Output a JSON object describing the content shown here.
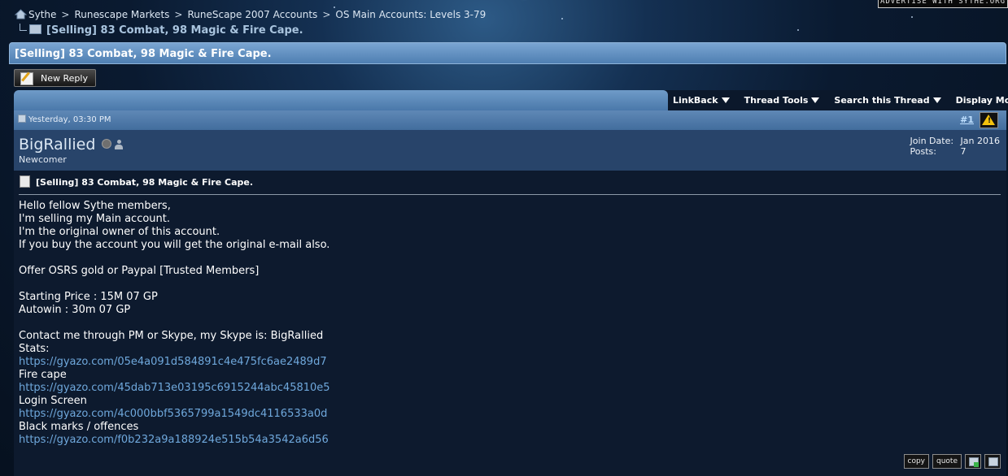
{
  "advertise": "ADVERTISE WITH SYTHE.ORG",
  "breadcrumb": {
    "items": [
      "Sythe",
      "Runescape Markets",
      "RuneScape 2007 Accounts",
      "OS Main Accounts: Levels 3-79"
    ],
    "separator": ">",
    "current": "[Selling] 83 Combat, 98 Magic & Fire Cape."
  },
  "thread": {
    "title": "[Selling] 83 Combat, 98 Magic & Fire Cape."
  },
  "toolbar": {
    "new_reply": "New Reply",
    "tools": [
      "LinkBack",
      "Thread Tools",
      "Search this Thread",
      "Display Modes"
    ]
  },
  "post": {
    "date": "Yesterday, 03:30 PM",
    "number": "#1",
    "username": "BigRallied",
    "usertitle": "Newcomer",
    "join_label": "Join Date:",
    "join_value": "Jan 2016",
    "posts_label": "Posts:",
    "posts_value": "7",
    "title": "[Selling] 83 Combat, 98 Magic & Fire Cape.",
    "lines": [
      "Hello fellow Sythe members,",
      "I'm selling my Main account.",
      "I'm the original owner of this account.",
      "If you buy the account you will get the original e-mail also.",
      "",
      "Offer OSRS gold or Paypal [Trusted Members]",
      "",
      "Starting Price : 15M 07 GP",
      "Autowin : 30m 07 GP",
      "",
      "Contact me through PM or Skype, my Skype is: BigRallied",
      "Stats:"
    ],
    "link1": "https://gyazo.com/05e4a091d584891c4e475fc6ae2489d7",
    "label2": "Fire cape",
    "link2": "https://gyazo.com/45dab713e03195c6915244abc45810e5",
    "label3": "Login Screen",
    "link3": "https://gyazo.com/4c000bbf5365799a1549dc4116533a0d",
    "label4": "Black marks / offences",
    "link4": "https://gyazo.com/f0b232a9a188924e515b54a3542a6d56",
    "copy_label": "copy",
    "quote_label": "quote"
  }
}
